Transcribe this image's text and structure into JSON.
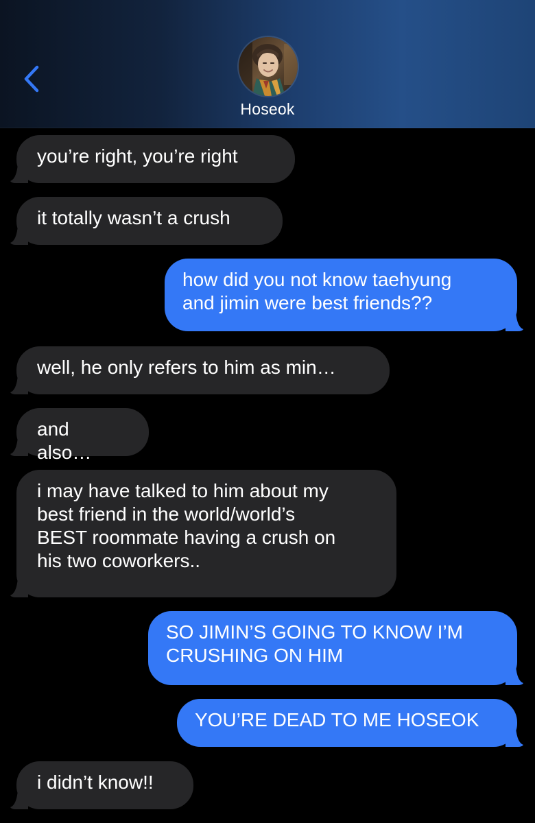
{
  "header": {
    "back_icon": "chevron-left-icon",
    "contact_name": "Hoseok",
    "accent_color": "#3478f6"
  },
  "messages": [
    {
      "direction": "incoming",
      "text": "you’re right, you’re right"
    },
    {
      "direction": "incoming",
      "text": "it totally wasn’t a crush"
    },
    {
      "direction": "outgoing",
      "text": "how did you not know taehyung\nand jimin were best friends??"
    },
    {
      "direction": "incoming",
      "text": "well, he only refers to him as min…"
    },
    {
      "direction": "incoming",
      "text": "and also…"
    },
    {
      "direction": "incoming",
      "text": "i may have talked to him about my\nbest friend in the world/world’s\nBEST roommate having a crush on\nhis two coworkers.."
    },
    {
      "direction": "outgoing",
      "text": "SO JIMIN’S GOING TO KNOW I’M\nCRUSHING ON HIM"
    },
    {
      "direction": "outgoing",
      "text": "YOU’RE DEAD TO ME HOSEOK"
    },
    {
      "direction": "incoming",
      "text": "i didn’t know!!"
    }
  ],
  "colors": {
    "incoming_bubble": "#262628",
    "outgoing_bubble": "#3478f6",
    "background": "#000000"
  }
}
